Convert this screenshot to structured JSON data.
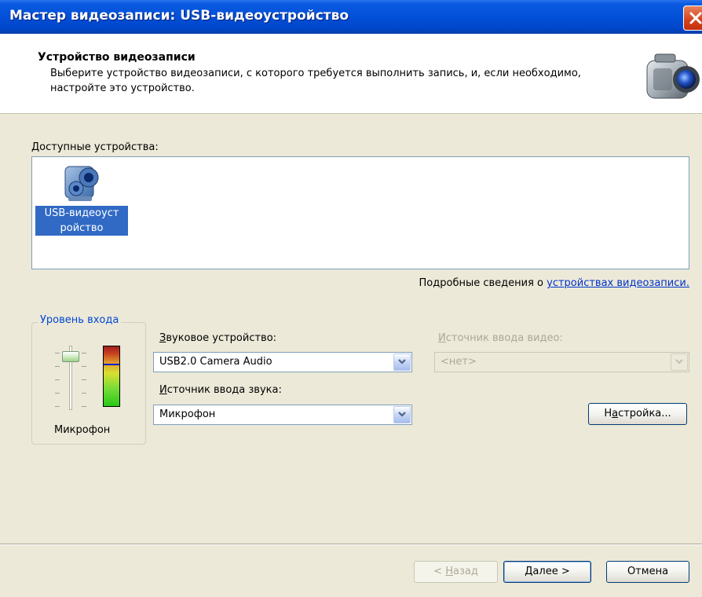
{
  "window": {
    "title": "Мастер видеозаписи: USB-видеоустройство"
  },
  "header": {
    "title": "Устройство видеозаписи",
    "description": "Выберите устройство видеозаписи, с которого требуется выполнить запись, и, если необходимо, настройте это устройство.",
    "icon": "video-camera-icon"
  },
  "devices": {
    "label": "Доступные устройства:",
    "items": [
      {
        "name": "USB-видеоустройство",
        "label_line1": "USB-видеоуст",
        "label_line2": "ройство",
        "selected": true,
        "icon": "webcam-icon"
      }
    ]
  },
  "details": {
    "prefix": "Подробные сведения о ",
    "link_text": "устройствах видеозаписи."
  },
  "input_level": {
    "legend": "Уровень входа",
    "source_label": "Микрофон"
  },
  "audio_device": {
    "label_accel": "З",
    "label_rest": "вуковое устройство:",
    "value": "USB2.0 Camera Audio"
  },
  "audio_source": {
    "label_accel": "И",
    "label_rest": "сточник ввода звука:",
    "value": "Микрофон"
  },
  "video_source": {
    "label_accel": "И",
    "label_rest": "сточник ввода видео:",
    "value": "<нет>",
    "enabled": false
  },
  "buttons": {
    "settings": {
      "accel_pre": "Н",
      "accel": "а",
      "rest": "стройка..."
    },
    "back": {
      "pre": "< ",
      "accel": "Н",
      "rest": "азад",
      "enabled": false
    },
    "next": {
      "accel": "Д",
      "rest": "алее >"
    },
    "cancel": {
      "label": "Отмена"
    }
  },
  "colors": {
    "title_bar": "#0250d8",
    "selection": "#316ac5",
    "link": "#0033cc"
  }
}
